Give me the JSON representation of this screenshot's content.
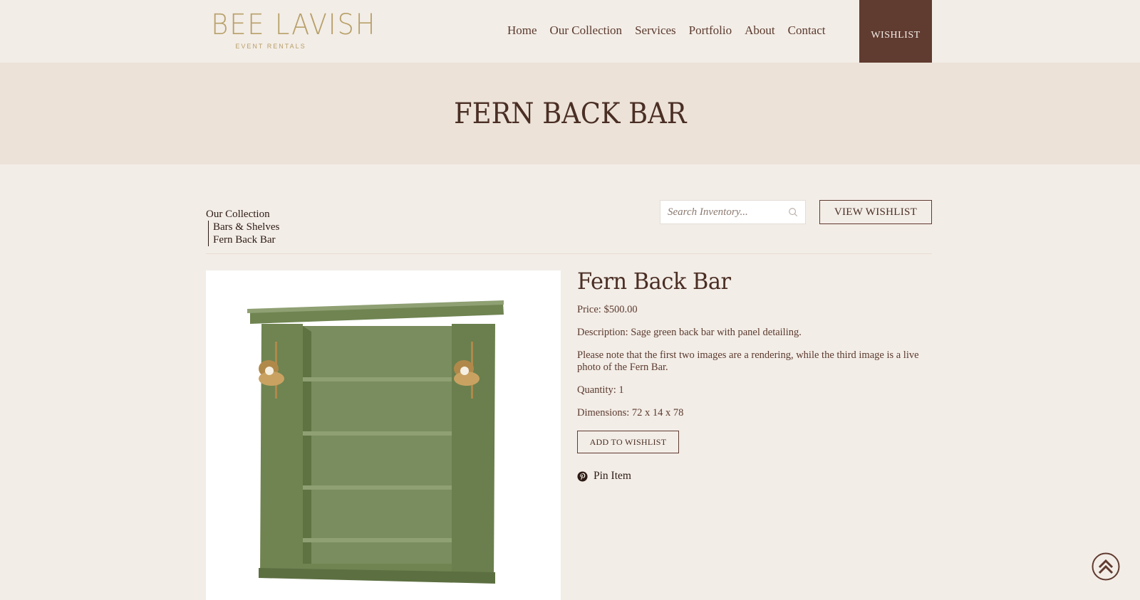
{
  "header": {
    "logo": {
      "main": "BEE LAVISH",
      "sub": "EVENT RENTALS"
    },
    "nav": [
      "Home",
      "Our Collection",
      "Services",
      "Portfolio",
      "About",
      "Contact"
    ],
    "wishlist_label": "WISHLIST"
  },
  "banner": {
    "title": "FERN BACK BAR"
  },
  "breadcrumb": {
    "root": "Our Collection",
    "category": "Bars & Shelves",
    "item": "Fern Back Bar"
  },
  "search": {
    "placeholder": "Search Inventory...",
    "icon": "search-icon"
  },
  "view_wishlist_label": "VIEW WISHLIST",
  "product": {
    "name": "Fern Back Bar",
    "price": "Price: $500.00",
    "description": "Description: Sage green back bar with panel detailing.",
    "note": "Please note that the first two images are a rendering, while the third image is a live photo of the Fern Bar.",
    "quantity": "Quantity: 1",
    "dimensions": "Dimensions: 72 x 14 x 78",
    "add_to_wishlist_label": "ADD TO WISHLIST",
    "pin_label": "Pin Item",
    "image_color": "#7a8d5e"
  },
  "colors": {
    "accent": "#603b30",
    "background": "#f3ede7",
    "banner": "#ece2d8",
    "logo": "#b8a06a"
  }
}
